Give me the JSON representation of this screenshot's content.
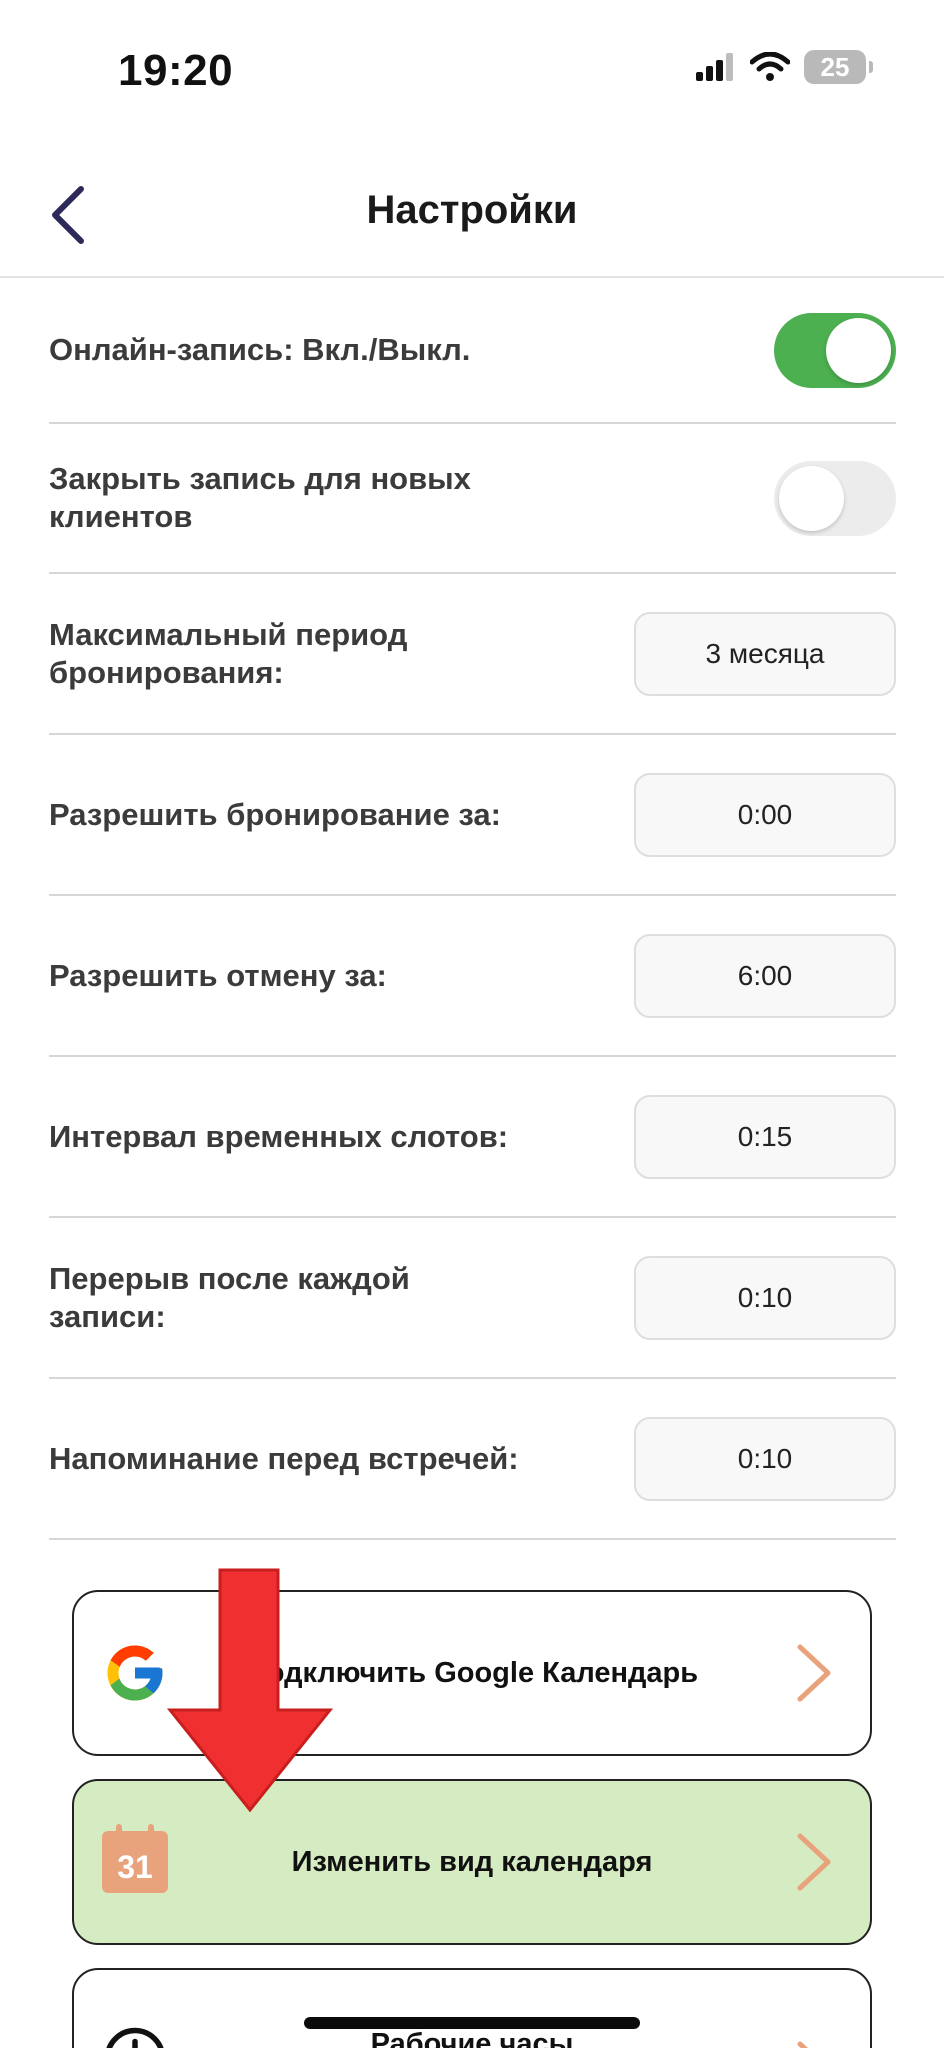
{
  "status_bar": {
    "time": "19:20",
    "battery": "25"
  },
  "header": {
    "title": "Настройки"
  },
  "settings": {
    "online_booking": {
      "label": "Онлайн-запись: Вкл./Выкл.",
      "enabled": true
    },
    "close_for_new": {
      "label": "Закрыть запись для новых клиентов",
      "enabled": false
    },
    "max_period": {
      "label": "Максимальный период бронирования:",
      "value": "3 месяца"
    },
    "allow_booking": {
      "label": "Разрешить бронирование за:",
      "value": "0:00"
    },
    "allow_cancel": {
      "label": "Разрешить отмену за:",
      "value": "6:00"
    },
    "slot_interval": {
      "label": "Интервал временных слотов:",
      "value": "0:15"
    },
    "break_after": {
      "label": "Перерыв после каждой записи:",
      "value": "0:10"
    },
    "reminder": {
      "label": "Напоминание перед встречей:",
      "value": "0:10"
    }
  },
  "actions": {
    "google": {
      "label": "Подключить Google Календарь",
      "icon": "google-icon"
    },
    "calendar_view": {
      "label": "Изменить вид календаря",
      "icon": "calendar-icon",
      "icon_text": "31"
    },
    "work_hours": {
      "label": "Рабочие часы",
      "icon": "clock-icon"
    }
  },
  "colors": {
    "toggle_on": "#4caf50",
    "chevron": "#e8a27c",
    "highlight_card": "#d5ecc2",
    "annotation_arrow": "#f03030"
  }
}
